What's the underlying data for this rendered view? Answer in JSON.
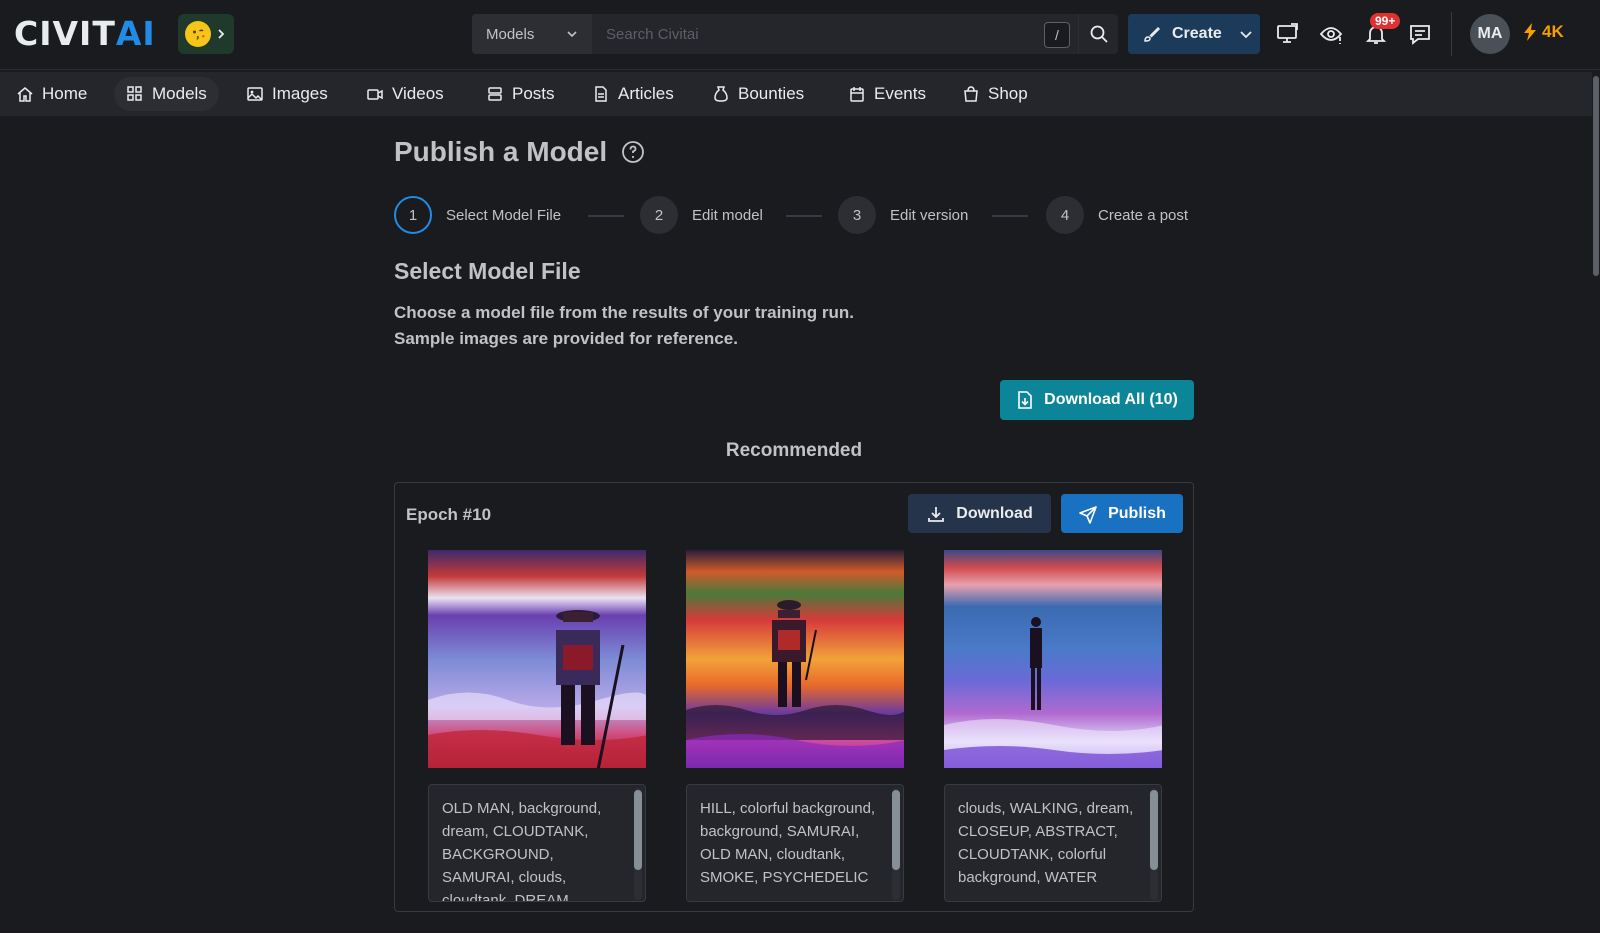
{
  "app": {
    "logo_civ": "CIVIT",
    "logo_ai": "AI"
  },
  "topbar": {
    "search_scope": "Models",
    "search_placeholder": "Search Civitai",
    "search_shortcut": "/",
    "create_label": "Create",
    "notifications_badge": "99+",
    "avatar_initials": "MA",
    "buzz_amount": "4K"
  },
  "nav": {
    "items": [
      {
        "label": "Home",
        "icon": "home-icon"
      },
      {
        "label": "Models",
        "icon": "grid-icon",
        "active": true
      },
      {
        "label": "Images",
        "icon": "image-icon"
      },
      {
        "label": "Videos",
        "icon": "video-icon"
      },
      {
        "label": "Posts",
        "icon": "posts-icon"
      },
      {
        "label": "Articles",
        "icon": "article-icon"
      },
      {
        "label": "Bounties",
        "icon": "bounty-icon"
      },
      {
        "label": "Events",
        "icon": "calendar-icon"
      },
      {
        "label": "Shop",
        "icon": "shop-icon"
      }
    ]
  },
  "page": {
    "title": "Publish a Model",
    "steps": [
      {
        "num": "1",
        "label": "Select Model File",
        "current": true
      },
      {
        "num": "2",
        "label": "Edit model"
      },
      {
        "num": "3",
        "label": "Edit version"
      },
      {
        "num": "4",
        "label": "Create a post"
      }
    ],
    "section_title": "Select Model File",
    "description_line1": "Choose a model file from the results of your training run.",
    "description_line2": "Sample images are provided for reference.",
    "download_all_label": "Download All (10)",
    "recommended_label": "Recommended",
    "epoch": {
      "title": "Epoch #10",
      "download_label": "Download",
      "publish_label": "Publish",
      "samples": [
        {
          "prompt": "OLD MAN, background, dream, CLOUDTANK, BACKGROUND, SAMURAI, clouds, cloudtank, DREAM"
        },
        {
          "prompt": "HILL, colorful background, background, SAMURAI, OLD MAN, cloudtank, SMOKE, PSYCHEDELIC"
        },
        {
          "prompt": "clouds, WALKING, dream, CLOSEUP, ABSTRACT, CLOUDTANK, colorful background, WATER"
        }
      ]
    }
  },
  "colors": {
    "accent_blue": "#228be6",
    "teal_button": "#0c8599",
    "publish_button": "#1971c2",
    "buzz": "#f59f00",
    "badge_red": "#e03131"
  }
}
